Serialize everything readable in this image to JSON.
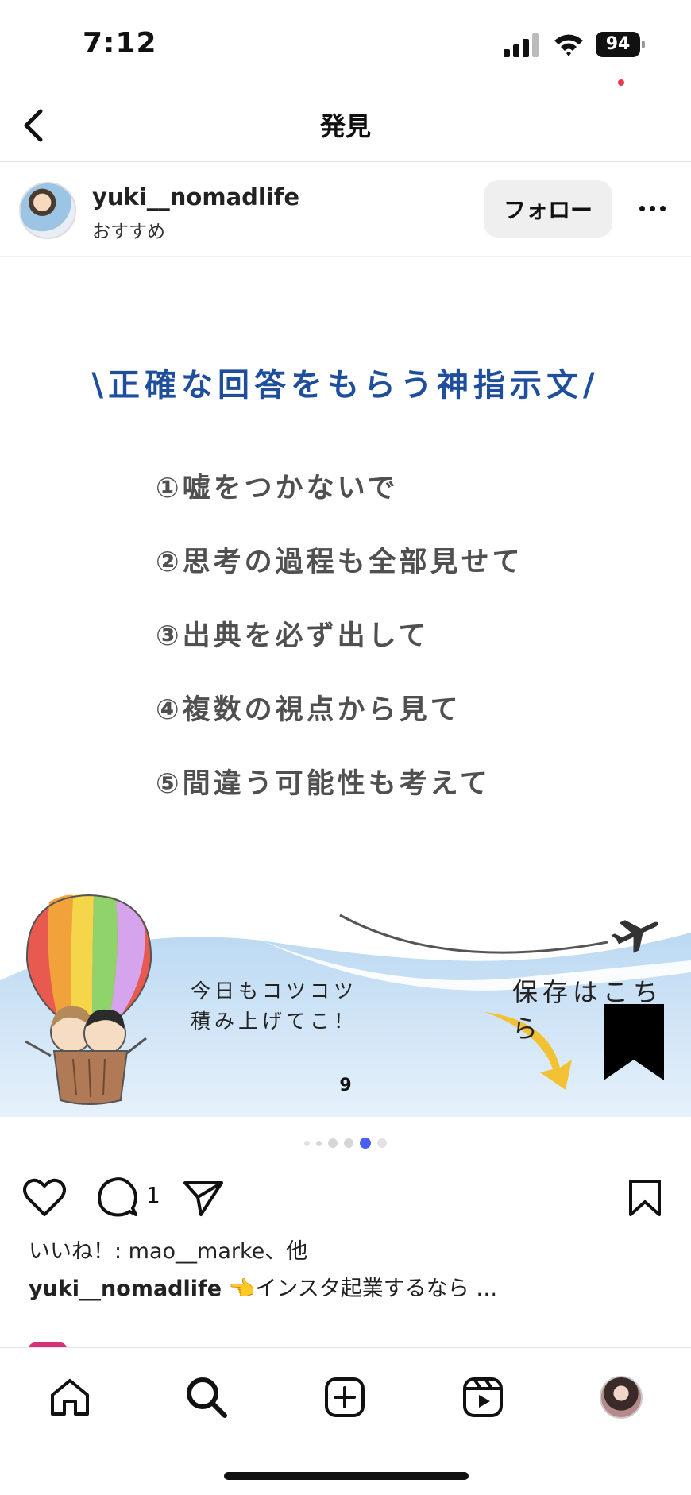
{
  "status_bar": {
    "time": "7:12",
    "battery": "94"
  },
  "header": {
    "title": "発見"
  },
  "post": {
    "username": "yuki__nomadlife",
    "subtitle": "おすすめ",
    "follow_label": "フォロー",
    "slide": {
      "title": "\\正確な回答をもらう神指示文/",
      "tips": [
        "①嘘をつかないで",
        "②思考の過程も全部見せて",
        "③出典を必ず出して",
        "④複数の視点から見て",
        "⑤間違う可能性も考えて"
      ],
      "caption_line1": "今日もコツコツ",
      "caption_line2": "積み上げてこ！",
      "save_label": "保存はこちら",
      "page_number": "9"
    },
    "carousel": {
      "total_dots": 6,
      "active_index": 4
    },
    "comment_count": "1",
    "likes_text": "いいね！: mao__marke、他",
    "caption_user": "yuki__nomadlife",
    "caption_text": " 👈インスタ起業するなら …"
  },
  "colors": {
    "title_blue": "#1f4f9c",
    "dot_active": "#4a5ef0",
    "arrow_yellow": "#f2c234",
    "sky": "#cfe3f5"
  },
  "icons": {
    "back": "chevron-left-icon",
    "like": "heart-icon",
    "comment": "comment-icon",
    "share": "send-icon",
    "save": "bookmark-icon",
    "tabs": [
      "home-icon",
      "search-icon",
      "create-icon",
      "reels-icon",
      "profile-avatar"
    ]
  }
}
